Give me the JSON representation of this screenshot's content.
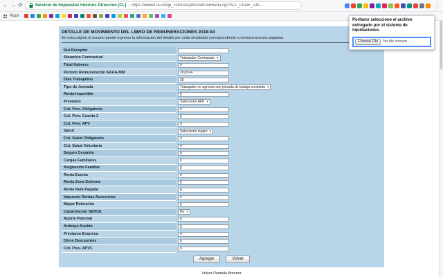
{
  "browser": {
    "ev_badge": "Servicio de Impuestos Internos Direccion [CL]",
    "separator": "|",
    "url": "https://www4.sii.cl/ogi_csm/DesptrsiGeh.brRienu.cgi?ALL_PAGE_AN...",
    "apps_label": "Apps",
    "extension_icons": [
      {
        "name": "extension-icon",
        "color": "#4285f4"
      },
      {
        "name": "extension-icon",
        "color": "#ea4335"
      },
      {
        "name": "extension-icon",
        "color": "#34a853"
      },
      {
        "name": "extension-icon",
        "color": "#fbbc05"
      },
      {
        "name": "extension-icon",
        "color": "#7b1fa2"
      },
      {
        "name": "extension-icon",
        "color": "#00acc1"
      },
      {
        "name": "extension-icon",
        "color": "#e91e63"
      },
      {
        "name": "extension-icon",
        "color": "#8bc34a"
      },
      {
        "name": "extension-icon",
        "color": "#ff5722"
      },
      {
        "name": "extension-icon",
        "color": "#3f51b5"
      },
      {
        "name": "extension-icon",
        "color": "#009688"
      },
      {
        "name": "extension-icon",
        "color": "#f44336"
      },
      {
        "name": "extension-icon",
        "color": "#607d8b"
      },
      {
        "name": "extension-icon",
        "color": "#fb8c00"
      }
    ],
    "bookmark_icons": [
      {
        "name": "bookmark-icon",
        "color": "#e53935"
      },
      {
        "name": "bookmark-icon",
        "color": "#1e88e5"
      },
      {
        "name": "bookmark-icon",
        "color": "#43a047"
      },
      {
        "name": "bookmark-icon",
        "color": "#fb8c00"
      },
      {
        "name": "bookmark-icon",
        "color": "#8e24aa"
      },
      {
        "name": "bookmark-icon",
        "color": "#00acc1"
      },
      {
        "name": "bookmark-icon",
        "color": "#fdd835"
      },
      {
        "name": "bookmark-icon",
        "color": "#d81b60"
      },
      {
        "name": "bookmark-icon",
        "color": "#3949ab"
      },
      {
        "name": "bookmark-icon",
        "color": "#00897b"
      },
      {
        "name": "bookmark-icon",
        "color": "#f4511e"
      },
      {
        "name": "bookmark-icon",
        "color": "#6d4c41"
      },
      {
        "name": "bookmark-icon",
        "color": "#7cb342"
      },
      {
        "name": "bookmark-icon",
        "color": "#5e35b1"
      },
      {
        "name": "bookmark-icon",
        "color": "#039be5"
      },
      {
        "name": "bookmark-icon",
        "color": "#c0ca33"
      },
      {
        "name": "bookmark-icon",
        "color": "#ef5350"
      },
      {
        "name": "bookmark-icon",
        "color": "#26a69a"
      },
      {
        "name": "bookmark-icon",
        "color": "#5c6bc0"
      },
      {
        "name": "bookmark-icon",
        "color": "#ffa726"
      },
      {
        "name": "bookmark-icon",
        "color": "#66bb6a"
      },
      {
        "name": "bookmark-icon",
        "color": "#ab47bc"
      },
      {
        "name": "bookmark-icon",
        "color": "#29b6f6"
      },
      {
        "name": "bookmark-icon",
        "color": "#ec407a"
      }
    ]
  },
  "popup": {
    "message": "Porfavor seleccione el archivo entregado por el sistema de liquidaciones.",
    "choose_file_label": "Choose File",
    "no_file_text": "No file chosen"
  },
  "page": {
    "title": "DETALLE DE MOVIMIENTO DEL LIBRO DE REMUNERACIONES 2018-04",
    "subtitle": "En esta página el usuario puede ingresar la información del detalle por cada empleado correspondiente a remuneraciones pagadas",
    "buttons": {
      "add": "Agregar",
      "back": "Volver"
    },
    "footer_link": "Volver Pantalla Anterior"
  },
  "form": {
    "rows": [
      {
        "label": "Rut Receptor",
        "type": "text",
        "value": ""
      },
      {
        "label": "Situación Contractual",
        "type": "select",
        "value": "Trabajador Contratado"
      },
      {
        "label": "Total Haberes",
        "type": "text",
        "value": "0"
      },
      {
        "label": "Período Remuneración AAAA-MM",
        "type": "text",
        "value": "2018-04"
      },
      {
        "label": "Días Trabajados",
        "type": "text",
        "value": "30"
      },
      {
        "label": "Tipo de Jornada",
        "type": "select",
        "value": "Trabajador no agrícola con jornada de trabajo completa"
      },
      {
        "label": "Renta Imponible",
        "type": "text",
        "value": "0"
      },
      {
        "label": "Previsión",
        "type": "select",
        "value": "Seleccione AFP"
      },
      {
        "label": "Cot. Prev. Obligatoria",
        "type": "text",
        "value": "0"
      },
      {
        "label": "Cot. Prev. Cuenta 2",
        "type": "text",
        "value": "0"
      },
      {
        "label": "Cot. Prev. APV",
        "type": "text",
        "value": "0"
      },
      {
        "label": "Salud",
        "type": "select",
        "value": "Seleccione Isapre"
      },
      {
        "label": "Cot. Salud Obligatoria",
        "type": "text",
        "value": "0"
      },
      {
        "label": "Cot. Salud Voluntaria",
        "type": "text",
        "value": "0"
      },
      {
        "label": "Seguro Cesantía",
        "type": "text",
        "value": "0"
      },
      {
        "label": "Cargas Familiares",
        "type": "text",
        "value": "0"
      },
      {
        "label": "Asignación Familiar",
        "type": "text",
        "value": "0"
      },
      {
        "label": "Renta Exenta",
        "type": "text",
        "value": "0"
      },
      {
        "label": "Renta Zona Extrema",
        "type": "text",
        "value": "0"
      },
      {
        "label": "Renta Neta Pagada",
        "type": "text",
        "value": "0"
      },
      {
        "label": "Impuesto Rentas Accesorias",
        "type": "text",
        "value": "0"
      },
      {
        "label": "Mayor Retención",
        "type": "text",
        "value": "0"
      },
      {
        "label": "Capacitación SENCE",
        "type": "select",
        "value": "No"
      },
      {
        "label": "Aporte Patronal",
        "type": "text",
        "value": "0"
      },
      {
        "label": "Anticipo Sueldo",
        "type": "text",
        "value": "0"
      },
      {
        "label": "Préstamo Empresa",
        "type": "text",
        "value": "0"
      },
      {
        "label": "Otros Descuentos",
        "type": "text",
        "value": "0"
      },
      {
        "label": "Cot. Prev. APVC",
        "type": "text",
        "value": "0"
      }
    ]
  },
  "colors": {
    "panel-blue": "#b9d5e9",
    "label-a": "#a9cade",
    "label-b": "#bcd6e8",
    "ev-green": "#0b8043",
    "focus-blue": "#4d90fe"
  }
}
